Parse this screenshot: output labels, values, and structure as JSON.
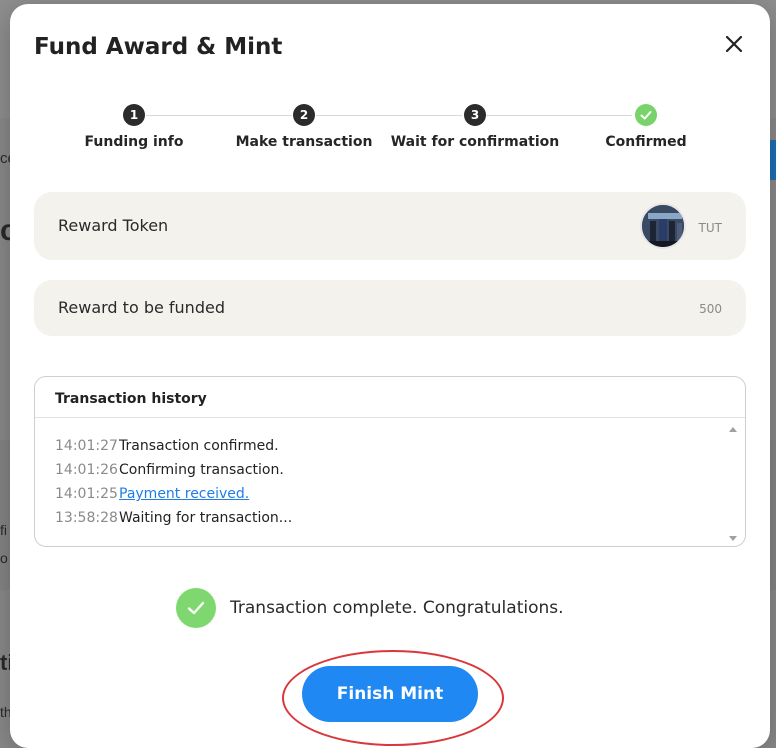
{
  "background": {
    "fragments": [
      "ce",
      "o",
      "c",
      "fi",
      "o",
      "ti",
      "th"
    ]
  },
  "modal": {
    "title": "Fund Award & Mint",
    "close_icon": "close-icon"
  },
  "stepper": {
    "steps": [
      {
        "number": "1",
        "label": "Funding info",
        "status": "completed"
      },
      {
        "number": "2",
        "label": "Make transaction",
        "status": "completed"
      },
      {
        "number": "3",
        "label": "Wait for confirmation",
        "status": "completed"
      },
      {
        "number": "",
        "label": "Confirmed",
        "status": "done",
        "icon": "check-icon"
      }
    ]
  },
  "reward_token": {
    "label": "Reward Token",
    "symbol": "TUT"
  },
  "reward_amount": {
    "label": "Reward to be funded",
    "value": "500"
  },
  "history": {
    "title": "Transaction history",
    "entries": [
      {
        "time": "14:01:27",
        "message": "Transaction confirmed.",
        "is_link": false
      },
      {
        "time": "14:01:26",
        "message": "Confirming transaction.",
        "is_link": false
      },
      {
        "time": "14:01:25",
        "message": "Payment received.",
        "is_link": true
      },
      {
        "time": "13:58:28",
        "message": "Waiting for transaction...",
        "is_link": false
      }
    ]
  },
  "status": {
    "message": "Transaction complete. Congratulations.",
    "icon": "check-circle-icon"
  },
  "actions": {
    "finish_label": "Finish Mint"
  },
  "colors": {
    "primary": "#1f88f2",
    "success": "#79d36b",
    "link": "#1f7de6",
    "highlight": "#d9373b"
  }
}
